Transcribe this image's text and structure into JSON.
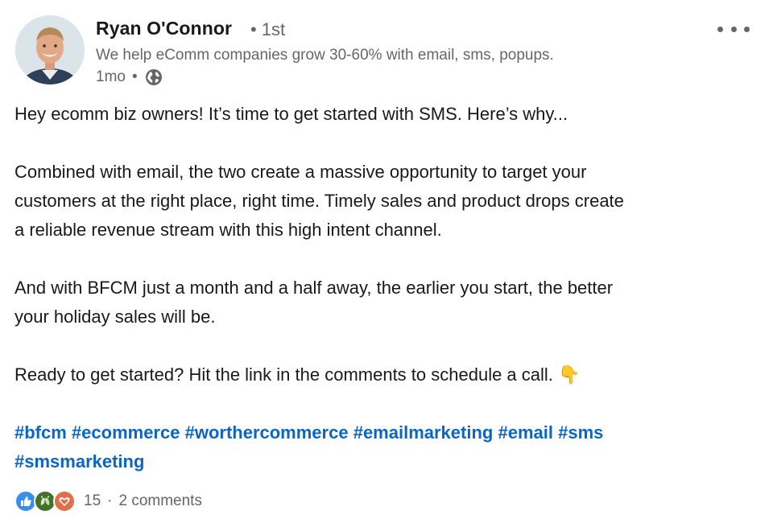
{
  "author": {
    "name": "Ryan O'Connor",
    "degree": "• 1st",
    "headline": "We help eComm companies grow 30-60% with email, sms, popups.",
    "time": "1mo",
    "separator": "•"
  },
  "post": {
    "paragraph1": "Hey ecomm biz owners! It’s time to get started with SMS. Here’s why...",
    "paragraph2_line1": "Combined with email, the two create a massive opportunity to target your",
    "paragraph2_line2": "customers at the right place, right time. Timely sales and product drops create",
    "paragraph2_line3": "a reliable revenue stream with this high intent channel.",
    "paragraph3_line1": "And with BFCM just a month and a half away, the earlier you start, the better",
    "paragraph3_line2": "your holiday sales will be.",
    "paragraph4": "Ready to get started? Hit the link in the comments to schedule a call.",
    "emoji": "👇",
    "hashtags": [
      "#bfcm",
      "#ecommerce",
      "#worthercommerce",
      "#emailmarketing",
      "#email",
      "#sms",
      "#smsmarketing"
    ]
  },
  "social": {
    "reaction_count": "15",
    "separator": "·",
    "comments": "2 comments",
    "reactions": [
      "like-icon",
      "celebrate-icon",
      "love-icon"
    ]
  },
  "colors": {
    "link": "#0a66c2",
    "muted": "#666666",
    "like": "#378fe9",
    "celebrate": "#44712e",
    "love": "#df704d"
  }
}
